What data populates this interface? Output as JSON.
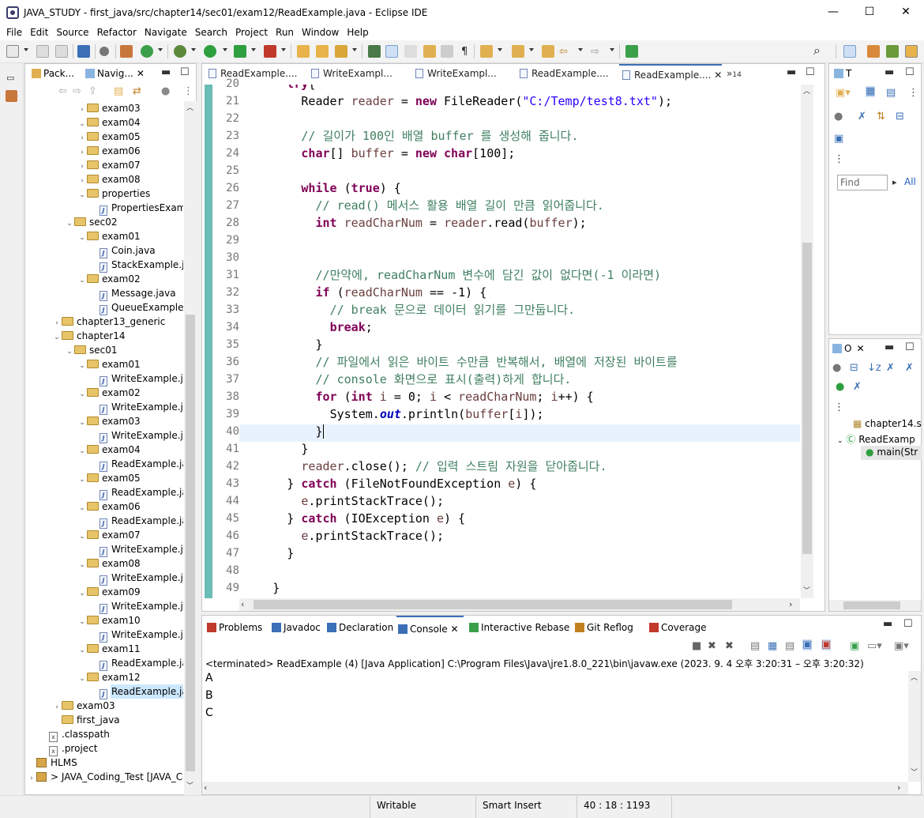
{
  "window": {
    "title": "JAVA_STUDY - first_java/src/chapter14/sec01/exam12/ReadExample.java - Eclipse IDE"
  },
  "menu": [
    "File",
    "Edit",
    "Source",
    "Refactor",
    "Navigate",
    "Search",
    "Project",
    "Run",
    "Window",
    "Help"
  ],
  "explorer": {
    "tabs": [
      "Pack...",
      "Navig..."
    ],
    "tree": [
      {
        "indent": 3,
        "twisty": "›",
        "kind": "folder",
        "label": "exam03"
      },
      {
        "indent": 3,
        "twisty": "⌄",
        "kind": "folder",
        "label": "exam04"
      },
      {
        "indent": 3,
        "twisty": "›",
        "kind": "folder",
        "label": "exam05"
      },
      {
        "indent": 3,
        "twisty": "›",
        "kind": "folder",
        "label": "exam06"
      },
      {
        "indent": 3,
        "twisty": "›",
        "kind": "folder",
        "label": "exam07"
      },
      {
        "indent": 3,
        "twisty": "›",
        "kind": "folder",
        "label": "exam08"
      },
      {
        "indent": 3,
        "twisty": "⌄",
        "kind": "folder",
        "label": "properties"
      },
      {
        "indent": 4,
        "twisty": "",
        "kind": "java",
        "label": "PropertiesExample."
      },
      {
        "indent": 2,
        "twisty": "⌄",
        "kind": "folder",
        "label": "sec02"
      },
      {
        "indent": 3,
        "twisty": "⌄",
        "kind": "folder",
        "label": "exam01"
      },
      {
        "indent": 4,
        "twisty": "",
        "kind": "java",
        "label": "Coin.java"
      },
      {
        "indent": 4,
        "twisty": "",
        "kind": "java",
        "label": "StackExample.java"
      },
      {
        "indent": 3,
        "twisty": "⌄",
        "kind": "folder",
        "label": "exam02"
      },
      {
        "indent": 4,
        "twisty": "",
        "kind": "java",
        "label": "Message.java"
      },
      {
        "indent": 4,
        "twisty": "",
        "kind": "java",
        "label": "QueueExample.java"
      },
      {
        "indent": 1,
        "twisty": "›",
        "kind": "folder",
        "label": "chapter13_generic"
      },
      {
        "indent": 1,
        "twisty": "⌄",
        "kind": "folder",
        "label": "chapter14"
      },
      {
        "indent": 2,
        "twisty": "⌄",
        "kind": "folder",
        "label": "sec01"
      },
      {
        "indent": 3,
        "twisty": "⌄",
        "kind": "folder",
        "label": "exam01"
      },
      {
        "indent": 4,
        "twisty": "",
        "kind": "java",
        "label": "WriteExample.java"
      },
      {
        "indent": 3,
        "twisty": "⌄",
        "kind": "folder",
        "label": "exam02"
      },
      {
        "indent": 4,
        "twisty": "",
        "kind": "java",
        "label": "WriteExample.java"
      },
      {
        "indent": 3,
        "twisty": "⌄",
        "kind": "folder",
        "label": "exam03"
      },
      {
        "indent": 4,
        "twisty": "",
        "kind": "java",
        "label": "WriteExample.java"
      },
      {
        "indent": 3,
        "twisty": "⌄",
        "kind": "folder",
        "label": "exam04"
      },
      {
        "indent": 4,
        "twisty": "",
        "kind": "java",
        "label": "ReadExample.java"
      },
      {
        "indent": 3,
        "twisty": "⌄",
        "kind": "folder",
        "label": "exam05"
      },
      {
        "indent": 4,
        "twisty": "",
        "kind": "java",
        "label": "ReadExample.java"
      },
      {
        "indent": 3,
        "twisty": "⌄",
        "kind": "folder",
        "label": "exam06"
      },
      {
        "indent": 4,
        "twisty": "",
        "kind": "java",
        "label": "ReadExample.java"
      },
      {
        "indent": 3,
        "twisty": "⌄",
        "kind": "folder",
        "label": "exam07"
      },
      {
        "indent": 4,
        "twisty": "",
        "kind": "java",
        "label": "WriteExample.java"
      },
      {
        "indent": 3,
        "twisty": "⌄",
        "kind": "folder",
        "label": "exam08"
      },
      {
        "indent": 4,
        "twisty": "",
        "kind": "java",
        "label": "WriteExample.java"
      },
      {
        "indent": 3,
        "twisty": "⌄",
        "kind": "folder",
        "label": "exam09"
      },
      {
        "indent": 4,
        "twisty": "",
        "kind": "java",
        "label": "WriteExample.java"
      },
      {
        "indent": 3,
        "twisty": "⌄",
        "kind": "folder",
        "label": "exam10"
      },
      {
        "indent": 4,
        "twisty": "",
        "kind": "java",
        "label": "WriteExample.java"
      },
      {
        "indent": 3,
        "twisty": "⌄",
        "kind": "folder",
        "label": "exam11"
      },
      {
        "indent": 4,
        "twisty": "",
        "kind": "java",
        "label": "ReadExample.java"
      },
      {
        "indent": 3,
        "twisty": "⌄",
        "kind": "folder",
        "label": "exam12"
      },
      {
        "indent": 4,
        "twisty": "",
        "kind": "java",
        "label": "ReadExample.java",
        "selected": true
      },
      {
        "indent": 1,
        "twisty": "›",
        "kind": "folder",
        "label": "exam03"
      },
      {
        "indent": 1,
        "twisty": "",
        "kind": "folder",
        "label": "first_java"
      },
      {
        "indent": 0,
        "twisty": "",
        "kind": "x",
        "label": ".classpath"
      },
      {
        "indent": 0,
        "twisty": "",
        "kind": "x",
        "label": ".project"
      },
      {
        "indent": -1,
        "twisty": "",
        "kind": "proj",
        "label": "HLMS"
      },
      {
        "indent": -1,
        "twisty": "›",
        "kind": "proj",
        "label": "> JAVA_Coding_Test [JAVA_Codir"
      }
    ]
  },
  "editor": {
    "tabs": [
      "ReadExample....",
      "WriteExampl...",
      "WriteExampl...",
      "ReadExample....",
      "ReadExample...."
    ],
    "overflow": "»",
    "overflow_count": "14",
    "lines": [
      {
        "n": "20",
        "t": [
          [
            "kw",
            "try"
          ],
          [
            "",
            "{"
          ]
        ],
        "ind": 6
      },
      {
        "n": "21",
        "t": [
          [
            "",
            "Reader "
          ],
          [
            "var",
            "reader"
          ],
          [
            "",
            " = "
          ],
          [
            "kw",
            "new"
          ],
          [
            "",
            " FileReader("
          ],
          [
            "str",
            "\"C:/Temp/test8.txt\""
          ],
          [
            "",
            ");"
          ]
        ],
        "ind": 8
      },
      {
        "n": "22",
        "t": [],
        "ind": 0
      },
      {
        "n": "23",
        "t": [
          [
            "cm",
            "// 길이가 100인 배열 buffer 를 생성해 줍니다."
          ]
        ],
        "ind": 8
      },
      {
        "n": "24",
        "t": [
          [
            "kw",
            "char"
          ],
          [
            "",
            "[] "
          ],
          [
            "var",
            "buffer"
          ],
          [
            "",
            " = "
          ],
          [
            "kw",
            "new"
          ],
          [
            "",
            " "
          ],
          [
            "kw",
            "char"
          ],
          [
            "",
            "[100];"
          ]
        ],
        "ind": 8
      },
      {
        "n": "25",
        "t": [],
        "ind": 0
      },
      {
        "n": "26",
        "t": [
          [
            "kw",
            "while"
          ],
          [
            "",
            " ("
          ],
          [
            "kw",
            "true"
          ],
          [
            "",
            ") {"
          ]
        ],
        "ind": 8
      },
      {
        "n": "27",
        "t": [
          [
            "cm",
            "// read() 메서스 활용 배열 길이 만큼 읽어줍니다."
          ]
        ],
        "ind": 10
      },
      {
        "n": "28",
        "t": [
          [
            "kw",
            "int"
          ],
          [
            "",
            " "
          ],
          [
            "var",
            "readCharNum"
          ],
          [
            "",
            " = "
          ],
          [
            "var",
            "reader"
          ],
          [
            "",
            ".read("
          ],
          [
            "var",
            "buffer"
          ],
          [
            "",
            ");"
          ]
        ],
        "ind": 10
      },
      {
        "n": "29",
        "t": [],
        "ind": 0
      },
      {
        "n": "30",
        "t": [],
        "ind": 0
      },
      {
        "n": "31",
        "t": [
          [
            "cm",
            "//만약에, readCharNum 변수에 담긴 값이 없다면(-1 이라면)"
          ]
        ],
        "ind": 10
      },
      {
        "n": "32",
        "t": [
          [
            "kw",
            "if"
          ],
          [
            "",
            " ("
          ],
          [
            "var",
            "readCharNum"
          ],
          [
            "",
            " == -1) {"
          ]
        ],
        "ind": 10
      },
      {
        "n": "33",
        "t": [
          [
            "cm",
            "// break 문으로 데이터 읽기를 그만둡니다."
          ]
        ],
        "ind": 12
      },
      {
        "n": "34",
        "t": [
          [
            "kw",
            "break"
          ],
          [
            "",
            ";"
          ]
        ],
        "ind": 12
      },
      {
        "n": "35",
        "t": [
          [
            "",
            "}"
          ]
        ],
        "ind": 10
      },
      {
        "n": "36",
        "t": [
          [
            "cm",
            "// 파일에서 읽은 바이트 수만큼 반복해서, 배열에 저장된 바이트를"
          ]
        ],
        "ind": 10
      },
      {
        "n": "37",
        "t": [
          [
            "cm",
            "// console 화면으로 표시(출력)하게 합니다."
          ]
        ],
        "ind": 10
      },
      {
        "n": "38",
        "t": [
          [
            "kw",
            "for"
          ],
          [
            "",
            " ("
          ],
          [
            "kw",
            "int"
          ],
          [
            "",
            " "
          ],
          [
            "var",
            "i"
          ],
          [
            "",
            " = 0; "
          ],
          [
            "var",
            "i"
          ],
          [
            "",
            " < "
          ],
          [
            "var",
            "readCharNum"
          ],
          [
            "",
            "; "
          ],
          [
            "var",
            "i"
          ],
          [
            "",
            "++) {"
          ]
        ],
        "ind": 10
      },
      {
        "n": "39",
        "t": [
          [
            "",
            "System."
          ],
          [
            "fld",
            "out"
          ],
          [
            "",
            ".println("
          ],
          [
            "var",
            "buffer"
          ],
          [
            "",
            "["
          ],
          [
            "var",
            "i"
          ],
          [
            "",
            "]);"
          ]
        ],
        "ind": 12
      },
      {
        "n": "40",
        "t": [
          [
            "",
            "}"
          ]
        ],
        "ind": 10
      },
      {
        "n": "41",
        "t": [
          [
            "",
            "}"
          ]
        ],
        "ind": 8
      },
      {
        "n": "42",
        "t": [
          [
            "var",
            "reader"
          ],
          [
            "",
            ".close(); "
          ],
          [
            "cm",
            "// 입력 스트림 자원을 닫아줍니다."
          ]
        ],
        "ind": 8
      },
      {
        "n": "43",
        "t": [
          [
            "",
            "} "
          ],
          [
            "kw",
            "catch"
          ],
          [
            "",
            " (FileNotFoundException "
          ],
          [
            "var",
            "e"
          ],
          [
            "",
            ") {"
          ]
        ],
        "ind": 6
      },
      {
        "n": "44",
        "t": [
          [
            "var",
            "e"
          ],
          [
            "",
            ".printStackTrace();"
          ]
        ],
        "ind": 8
      },
      {
        "n": "45",
        "t": [
          [
            "",
            "} "
          ],
          [
            "kw",
            "catch"
          ],
          [
            "",
            " (IOException "
          ],
          [
            "var",
            "e"
          ],
          [
            "",
            ") {"
          ]
        ],
        "ind": 6
      },
      {
        "n": "46",
        "t": [
          [
            "var",
            "e"
          ],
          [
            "",
            ".printStackTrace();"
          ]
        ],
        "ind": 8
      },
      {
        "n": "47",
        "t": [
          [
            "",
            "}"
          ]
        ],
        "ind": 6
      },
      {
        "n": "48",
        "t": [],
        "ind": 0
      },
      {
        "n": "49",
        "t": [
          [
            "",
            "}"
          ]
        ],
        "ind": 4
      }
    ]
  },
  "right_top": {
    "tab": "T",
    "find_placeholder": "Find",
    "all_label": "All"
  },
  "right_bottom": {
    "tab": "O",
    "items": [
      "chapter14.s",
      "ReadExamp",
      "main(Str"
    ]
  },
  "console": {
    "tabs": [
      "Problems",
      "Javadoc",
      "Declaration",
      "Console",
      "Interactive Rebase",
      "Git Reflog",
      "Coverage"
    ],
    "header": "<terminated> ReadExample (4) [Java Application] C:\\Program Files\\Java\\jre1.8.0_221\\bin\\javaw.exe  (2023. 9. 4 오후 3:20:31 – 오후 3:20:32)",
    "output": [
      "A",
      "B",
      "C"
    ]
  },
  "status": {
    "writable": "Writable",
    "insert_mode": "Smart Insert",
    "position": "40 : 18 : 1193"
  }
}
